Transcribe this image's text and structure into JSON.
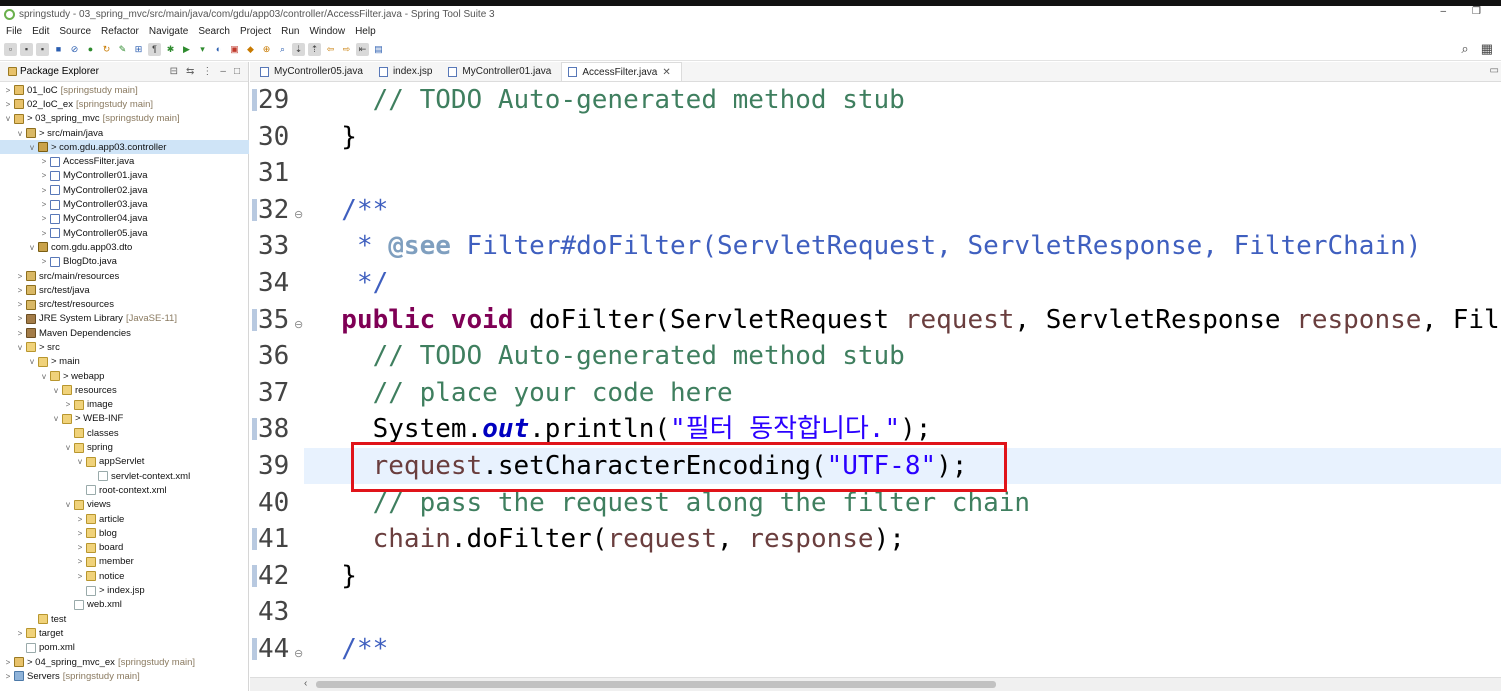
{
  "window": {
    "title": "springstudy - 03_spring_mvc/src/main/java/com/gdu/app03/controller/AccessFilter.java - Spring Tool Suite 3",
    "minimize": "–",
    "restore": "❐"
  },
  "menu": [
    "File",
    "Edit",
    "Source",
    "Refactor",
    "Navigate",
    "Search",
    "Project",
    "Run",
    "Window",
    "Help"
  ],
  "explorer": {
    "title": "Package Explorer",
    "tree": [
      {
        "indent": 0,
        "twisty": ">",
        "icon": "proj",
        "label": "01_IoC",
        "extra": "[springstudy main]"
      },
      {
        "indent": 0,
        "twisty": ">",
        "icon": "proj",
        "label": "02_IoC_ex",
        "extra": "[springstudy main]"
      },
      {
        "indent": 0,
        "twisty": "v",
        "icon": "proj",
        "label": "> 03_spring_mvc",
        "extra": "[springstudy main]"
      },
      {
        "indent": 1,
        "twisty": "v",
        "icon": "src",
        "label": "> src/main/java",
        "extra": ""
      },
      {
        "indent": 2,
        "twisty": "v",
        "icon": "pkg",
        "label": "> com.gdu.app03.controller",
        "extra": "",
        "selected": true
      },
      {
        "indent": 3,
        "twisty": ">",
        "icon": "java",
        "label": "AccessFilter.java",
        "extra": ""
      },
      {
        "indent": 3,
        "twisty": ">",
        "icon": "java",
        "label": "MyController01.java",
        "extra": ""
      },
      {
        "indent": 3,
        "twisty": ">",
        "icon": "java",
        "label": "MyController02.java",
        "extra": ""
      },
      {
        "indent": 3,
        "twisty": ">",
        "icon": "java",
        "label": "MyController03.java",
        "extra": ""
      },
      {
        "indent": 3,
        "twisty": ">",
        "icon": "java",
        "label": "MyController04.java",
        "extra": ""
      },
      {
        "indent": 3,
        "twisty": ">",
        "icon": "java",
        "label": "MyController05.java",
        "extra": ""
      },
      {
        "indent": 2,
        "twisty": "v",
        "icon": "pkg",
        "label": "com.gdu.app03.dto",
        "extra": ""
      },
      {
        "indent": 3,
        "twisty": ">",
        "icon": "java",
        "label": "BlogDto.java",
        "extra": ""
      },
      {
        "indent": 1,
        "twisty": ">",
        "icon": "src",
        "label": "src/main/resources",
        "extra": ""
      },
      {
        "indent": 1,
        "twisty": ">",
        "icon": "src",
        "label": "src/test/java",
        "extra": ""
      },
      {
        "indent": 1,
        "twisty": ">",
        "icon": "src",
        "label": "src/test/resources",
        "extra": ""
      },
      {
        "indent": 1,
        "twisty": ">",
        "icon": "lib",
        "label": "JRE System Library",
        "extra": "[JavaSE-11]"
      },
      {
        "indent": 1,
        "twisty": ">",
        "icon": "lib",
        "label": "Maven Dependencies",
        "extra": ""
      },
      {
        "indent": 1,
        "twisty": "v",
        "icon": "folder",
        "label": "> src",
        "extra": ""
      },
      {
        "indent": 2,
        "twisty": "v",
        "icon": "folder",
        "label": "> main",
        "extra": ""
      },
      {
        "indent": 3,
        "twisty": "v",
        "icon": "folder",
        "label": "> webapp",
        "extra": ""
      },
      {
        "indent": 4,
        "twisty": "v",
        "icon": "folder",
        "label": "resources",
        "extra": ""
      },
      {
        "indent": 5,
        "twisty": ">",
        "icon": "folder",
        "label": "image",
        "extra": ""
      },
      {
        "indent": 4,
        "twisty": "v",
        "icon": "folder",
        "label": "> WEB-INF",
        "extra": ""
      },
      {
        "indent": 5,
        "twisty": "",
        "icon": "folder",
        "label": "classes",
        "extra": ""
      },
      {
        "indent": 5,
        "twisty": "v",
        "icon": "folder",
        "label": "spring",
        "extra": ""
      },
      {
        "indent": 6,
        "twisty": "v",
        "icon": "folder",
        "label": "appServlet",
        "extra": ""
      },
      {
        "indent": 7,
        "twisty": "",
        "icon": "file",
        "label": "servlet-context.xml",
        "extra": ""
      },
      {
        "indent": 6,
        "twisty": "",
        "icon": "file",
        "label": "root-context.xml",
        "extra": ""
      },
      {
        "indent": 5,
        "twisty": "v",
        "icon": "folder",
        "label": "views",
        "extra": ""
      },
      {
        "indent": 6,
        "twisty": ">",
        "icon": "folder",
        "label": "article",
        "extra": ""
      },
      {
        "indent": 6,
        "twisty": ">",
        "icon": "folder",
        "label": "blog",
        "extra": ""
      },
      {
        "indent": 6,
        "twisty": ">",
        "icon": "folder",
        "label": "board",
        "extra": ""
      },
      {
        "indent": 6,
        "twisty": ">",
        "icon": "folder",
        "label": "member",
        "extra": ""
      },
      {
        "indent": 6,
        "twisty": ">",
        "icon": "folder",
        "label": "notice",
        "extra": ""
      },
      {
        "indent": 6,
        "twisty": "",
        "icon": "file",
        "label": "> index.jsp",
        "extra": ""
      },
      {
        "indent": 5,
        "twisty": "",
        "icon": "file",
        "label": "web.xml",
        "extra": ""
      },
      {
        "indent": 2,
        "twisty": "",
        "icon": "folder",
        "label": "test",
        "extra": ""
      },
      {
        "indent": 1,
        "twisty": ">",
        "icon": "folder",
        "label": "target",
        "extra": ""
      },
      {
        "indent": 1,
        "twisty": "",
        "icon": "file",
        "label": "pom.xml",
        "extra": ""
      },
      {
        "indent": 0,
        "twisty": ">",
        "icon": "proj",
        "label": "> 04_spring_mvc_ex",
        "extra": "[springstudy main]"
      },
      {
        "indent": 0,
        "twisty": ">",
        "icon": "server",
        "label": "Servers",
        "extra": "[springstudy main]"
      }
    ]
  },
  "tabs": [
    {
      "label": "MyController05.java",
      "active": false
    },
    {
      "label": "index.jsp",
      "active": false
    },
    {
      "label": "MyController01.java",
      "active": false
    },
    {
      "label": "AccessFilter.java",
      "active": true,
      "close": "✕"
    }
  ],
  "editor": {
    "lines": [
      {
        "num": "29",
        "fold": "",
        "parts": [
          [
            "cm",
            "    // TODO Auto-generated method stub"
          ]
        ]
      },
      {
        "num": "30",
        "fold": "",
        "parts": [
          [
            "",
            "  }"
          ]
        ]
      },
      {
        "num": "31",
        "fold": "",
        "parts": []
      },
      {
        "num": "32",
        "fold": "⊖",
        "parts": [
          [
            "jd",
            "  /**"
          ]
        ]
      },
      {
        "num": "33",
        "fold": "",
        "parts": [
          [
            "jd",
            "   * "
          ],
          [
            "tag",
            "@see"
          ],
          [
            "jd",
            " Filter#doFilter(ServletRequest, ServletResponse, FilterChain)"
          ]
        ]
      },
      {
        "num": "34",
        "fold": "",
        "parts": [
          [
            "jd",
            "   */"
          ]
        ]
      },
      {
        "num": "35",
        "fold": "⊖",
        "parts": [
          [
            "kw",
            "  public void"
          ],
          [
            "",
            " doFilter(ServletRequest "
          ],
          [
            "par",
            "request"
          ],
          [
            "",
            ", ServletResponse "
          ],
          [
            "par",
            "response"
          ],
          [
            "",
            ", Fil"
          ]
        ]
      },
      {
        "num": "36",
        "fold": "",
        "parts": [
          [
            "cm",
            "    // TODO Auto-generated method stub"
          ]
        ]
      },
      {
        "num": "37",
        "fold": "",
        "parts": [
          [
            "cm",
            "    // place your code here"
          ]
        ]
      },
      {
        "num": "38",
        "fold": "",
        "parts": [
          [
            "",
            "    System."
          ],
          [
            "fld",
            "out"
          ],
          [
            "",
            ".println("
          ],
          [
            "str",
            "\"필터 동작합니다.\""
          ],
          [
            "",
            ");"
          ]
        ]
      },
      {
        "num": "39",
        "fold": "",
        "current": true,
        "parts": [
          [
            "par",
            "    request"
          ],
          [
            "",
            ".setCharacterEncoding("
          ],
          [
            "str",
            "\"UTF-8\""
          ],
          [
            "",
            ");"
          ]
        ]
      },
      {
        "num": "40",
        "fold": "",
        "parts": [
          [
            "cm",
            "    // pass the request along the filter chain"
          ]
        ]
      },
      {
        "num": "41",
        "fold": "",
        "parts": [
          [
            "par",
            "    chain"
          ],
          [
            "",
            ".doFilter("
          ],
          [
            "par",
            "request"
          ],
          [
            "",
            ", "
          ],
          [
            "par",
            "response"
          ],
          [
            "",
            ");"
          ]
        ]
      },
      {
        "num": "42",
        "fold": "",
        "parts": [
          [
            "",
            "  }"
          ]
        ]
      },
      {
        "num": "43",
        "fold": "",
        "parts": []
      },
      {
        "num": "44",
        "fold": "⊖",
        "parts": [
          [
            "jd",
            "  /**"
          ]
        ]
      }
    ]
  },
  "colors": {
    "highlight_box": "#e0141a",
    "current_line": "#e8f2fe",
    "comment": "#3f7f5f",
    "keyword": "#7f0055",
    "string": "#2a00ff"
  }
}
